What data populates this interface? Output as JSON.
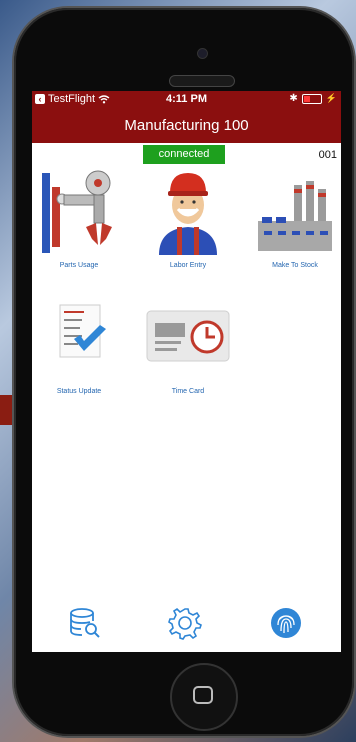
{
  "status_bar": {
    "carrier": "TestFlight",
    "time": "4:11 PM",
    "battery_percent": 0.4
  },
  "header": {
    "title": "Manufacturing 100"
  },
  "connection": {
    "status": "connected",
    "device_id": "001"
  },
  "menu": {
    "items": [
      {
        "label": "Parts Usage",
        "icon": "robot-arm-icon"
      },
      {
        "label": "Labor Entry",
        "icon": "worker-hardhat-icon"
      },
      {
        "label": "Make To Stock",
        "icon": "factory-icon"
      },
      {
        "label": "Status Update",
        "icon": "checklist-icon"
      },
      {
        "label": "Time Card",
        "icon": "time-card-icon"
      }
    ]
  },
  "toolbar": {
    "icons": [
      "database-search-icon",
      "settings-gear-icon",
      "fingerprint-icon"
    ]
  },
  "colors": {
    "brand": "#8b0f0f",
    "connected": "#1ea01e",
    "link": "#2466b0",
    "icon_blue": "#2f86d6"
  }
}
